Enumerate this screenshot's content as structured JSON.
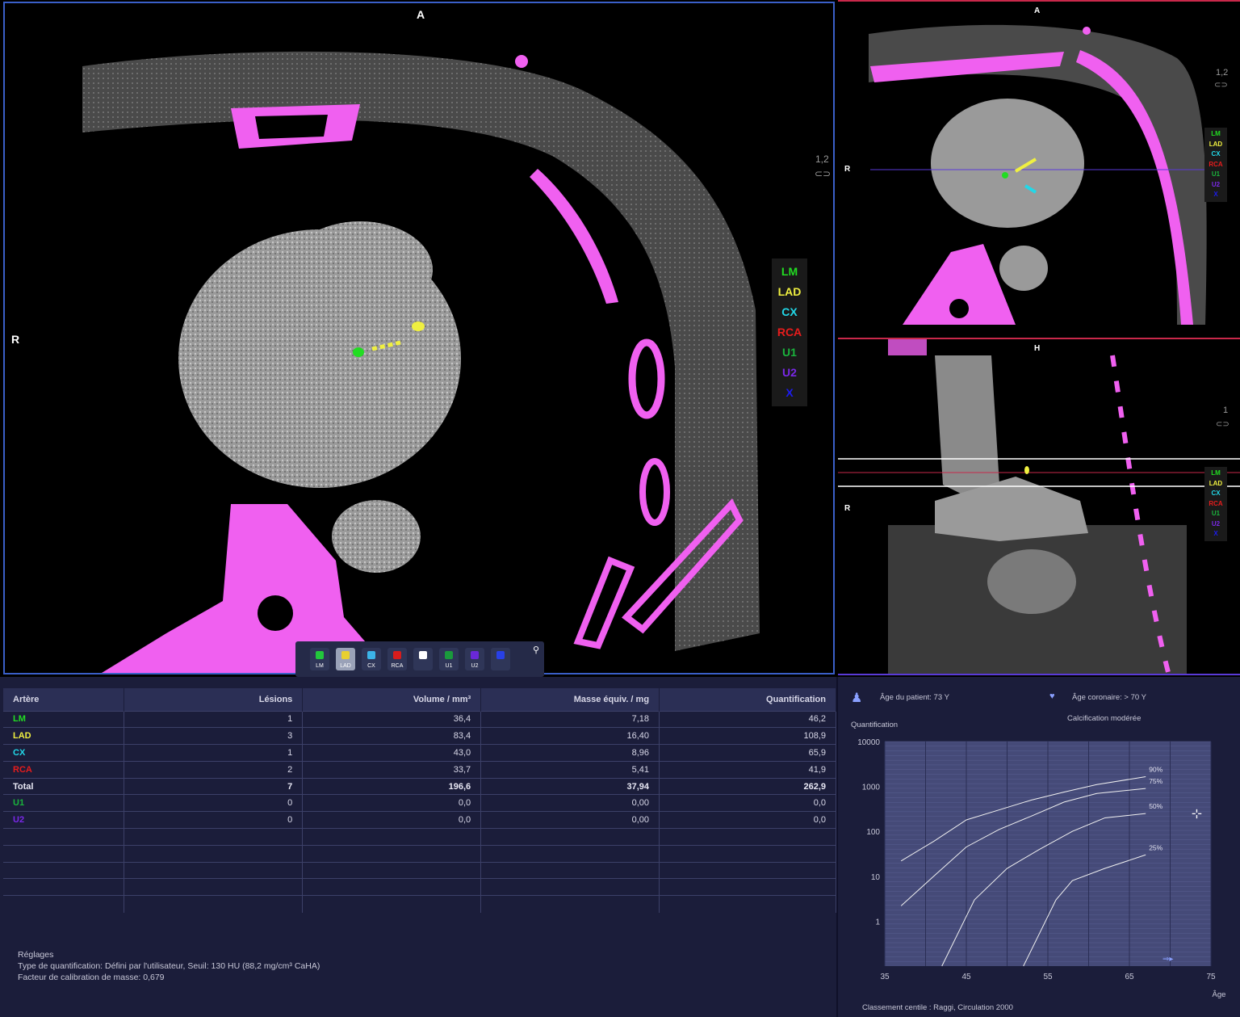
{
  "orientation": {
    "axial_top": "A",
    "axial_left": "R",
    "small_top": "A",
    "small_left": "R",
    "sag_top": "H",
    "sag_left": "R"
  },
  "zoom": {
    "axial": "1,2",
    "small": "1,2",
    "sagittal": "1"
  },
  "legend": [
    {
      "label": "LM",
      "color": "#22dd22"
    },
    {
      "label": "LAD",
      "color": "#f0f040"
    },
    {
      "label": "CX",
      "color": "#22d8e8"
    },
    {
      "label": "RCA",
      "color": "#e81c1c"
    },
    {
      "label": "U1",
      "color": "#1ab43c"
    },
    {
      "label": "U2",
      "color": "#7a28e8"
    },
    {
      "label": "X",
      "color": "#1c1cf0"
    }
  ],
  "toolbar": [
    {
      "label": "LM",
      "color": "#22c83c",
      "active": false
    },
    {
      "label": "LAD",
      "color": "#e8d030",
      "active": true
    },
    {
      "label": "CX",
      "color": "#3cb4e8",
      "active": false
    },
    {
      "label": "RCA",
      "color": "#d81c1c",
      "active": false
    },
    {
      "label": "",
      "color": "#ffffff",
      "active": false,
      "icon": "eraser-icon"
    },
    {
      "label": "U1",
      "color": "#1a9a3c",
      "active": false
    },
    {
      "label": "U2",
      "color": "#6a28d8",
      "active": false
    },
    {
      "label": "",
      "color": "#2840e8",
      "active": false,
      "icon": "x-icon"
    }
  ],
  "table": {
    "headers": [
      "Artère",
      "Lésions",
      "Volume / mm³",
      "Masse équiv. / mg",
      "Quantification"
    ],
    "rows": [
      {
        "artery": "LM",
        "color": "#22dd22",
        "lesions": "1",
        "volume": "36,4",
        "mass": "7,18",
        "quant": "46,2",
        "total": false
      },
      {
        "artery": "LAD",
        "color": "#f0f040",
        "lesions": "3",
        "volume": "83,4",
        "mass": "16,40",
        "quant": "108,9",
        "total": false
      },
      {
        "artery": "CX",
        "color": "#22d8e8",
        "lesions": "1",
        "volume": "43,0",
        "mass": "8,96",
        "quant": "65,9",
        "total": false
      },
      {
        "artery": "RCA",
        "color": "#e81c1c",
        "lesions": "2",
        "volume": "33,7",
        "mass": "5,41",
        "quant": "41,9",
        "total": false
      },
      {
        "artery": "Total",
        "color": "#e8e8f4",
        "lesions": "7",
        "volume": "196,6",
        "mass": "37,94",
        "quant": "262,9",
        "total": true
      },
      {
        "artery": "U1",
        "color": "#1ab43c",
        "lesions": "0",
        "volume": "0,0",
        "mass": "0,00",
        "quant": "0,0",
        "total": false
      },
      {
        "artery": "U2",
        "color": "#7a28e8",
        "lesions": "0",
        "volume": "0,0",
        "mass": "0,00",
        "quant": "0,0",
        "total": false
      }
    ],
    "empty_rows": 5
  },
  "settings": {
    "title": "Réglages",
    "line1": "Type de quantification: Défini par l'utilisateur, Seuil: 130 HU (88,2 mg/cm³ CaHA)",
    "line2": "Facteur de calibration de masse: 0,679"
  },
  "patient": {
    "age": "Âge du patient: 73 Y",
    "coronary_age": "Âge coronaire: > 70 Y",
    "classification": "Calcification modérée",
    "footer": "Classement centile : Raggi, Circulation 2000"
  },
  "chart_data": {
    "type": "line",
    "ylabel": "Quantification",
    "xlabel": "Âge",
    "yscale": "log",
    "ylim": [
      0.1,
      10000
    ],
    "xlim": [
      35,
      75
    ],
    "yticks": [
      "10000",
      "1000",
      "100",
      "10",
      "1"
    ],
    "xticks": [
      "35",
      "45",
      "55",
      "65",
      "75"
    ],
    "series": [
      {
        "name": "90%",
        "x": [
          37,
          41,
          45,
          49,
          53,
          57,
          61,
          67
        ],
        "y": [
          22,
          60,
          180,
          300,
          500,
          750,
          1100,
          1650
        ]
      },
      {
        "name": "75%",
        "x": [
          37,
          41,
          45,
          49,
          53,
          57,
          61,
          67
        ],
        "y": [
          2.2,
          10,
          45,
          110,
          220,
          450,
          700,
          900
        ]
      },
      {
        "name": "50%",
        "x": [
          42,
          46,
          50,
          54,
          58,
          62,
          67
        ],
        "y": [
          0.1,
          3,
          15,
          40,
          100,
          200,
          250
        ]
      },
      {
        "name": "25%",
        "x": [
          52,
          56,
          58,
          62,
          67
        ],
        "y": [
          0.1,
          3,
          8,
          15,
          30
        ]
      }
    ]
  }
}
